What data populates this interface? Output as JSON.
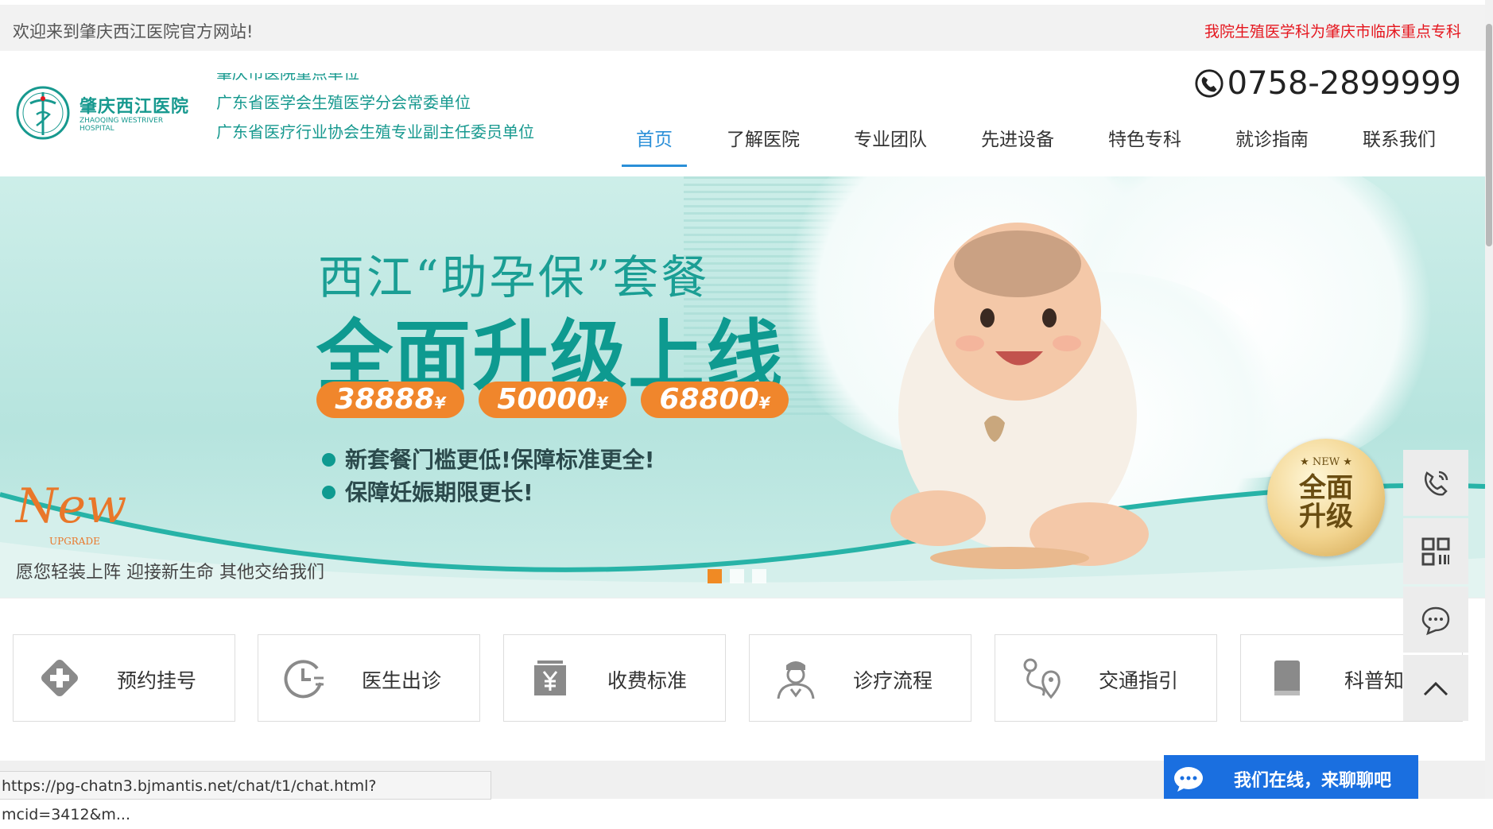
{
  "topbar": {
    "welcome": "欢迎来到肇庆西江医院官方网站!",
    "notice": "我院生殖医学科为肇庆市临床重点专科"
  },
  "header": {
    "logo_name": "肇庆西江医院",
    "logo_en": "ZHAOQING WESTRIVER HOSPITAL",
    "ticker": [
      "肇庆市医院重点单位",
      "广东省医学会生殖医学分会常委单位",
      "广东省医疗行业协会生殖专业副主任委员单位"
    ],
    "phone": "0758-2899999"
  },
  "nav": {
    "items": [
      "首页",
      "了解医院",
      "专业团队",
      "先进设备",
      "特色专科",
      "就诊指南",
      "联系我们"
    ],
    "active": "首页"
  },
  "banner": {
    "title": "西江“助孕保”套餐",
    "headline": "全面升级上线",
    "prices": [
      "38888",
      "50000",
      "68800"
    ],
    "currency": "¥",
    "bullets": [
      "新套餐门槛更低!保障标准更全!",
      "保障妊娠期限更长!"
    ],
    "badge_top": "★ NEW ★",
    "badge_text": [
      "全面",
      "升级"
    ],
    "new_mark": "New",
    "upgrade_mark": "UPGRADE",
    "slogan": "愿您轻装上阵 迎接新生命 其他交给我们",
    "slide_count": 3,
    "active_slide": 1
  },
  "quick_links": [
    {
      "label": "预约挂号",
      "icon": "appointment-icon"
    },
    {
      "label": "医生出诊",
      "icon": "clock-icon"
    },
    {
      "label": "收费标准",
      "icon": "yuan-fee-icon"
    },
    {
      "label": "诊疗流程",
      "icon": "doctor-icon"
    },
    {
      "label": "交通指引",
      "icon": "location-route-icon"
    },
    {
      "label": "科普知识",
      "icon": "book-icon"
    }
  ],
  "side_float": [
    "phone-icon",
    "qrcode-icon",
    "chat-icon",
    "back-to-top-icon"
  ],
  "chat": {
    "label": "我们在线，来聊聊吧"
  },
  "status_url": "https://pg-chatn3.bjmantis.net/chat/t1/chat.html?mcid=3412&m...",
  "colors": {
    "brand": "#17998f",
    "nav_active": "#2a8fd8",
    "notice": "#e5161e",
    "accent_orange": "#f0862c",
    "chat_blue": "#1a6fe0"
  }
}
